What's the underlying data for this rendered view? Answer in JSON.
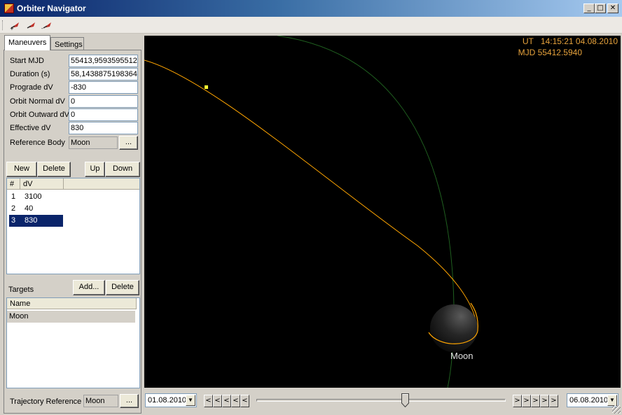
{
  "window": {
    "title": "Orbiter Navigator",
    "minimize": "_",
    "maximize": "□",
    "close": "✕"
  },
  "toolbar": {
    "icons": [
      "new-maneuver-icon",
      "edit-maneuver-icon",
      "delete-maneuver-icon"
    ]
  },
  "tabs": [
    {
      "label": "Maneuvers"
    },
    {
      "label": "Settings"
    }
  ],
  "maneuver_form": {
    "start_mjd": {
      "label": "Start MJD",
      "value": "55413,9593595512"
    },
    "duration": {
      "label": "Duration (s)",
      "value": "58,1438875198364"
    },
    "prograde": {
      "label": "Prograde dV",
      "value": "-830"
    },
    "normal": {
      "label": "Orbit Normal dV",
      "value": "0"
    },
    "outward": {
      "label": "Orbit Outward dV",
      "value": "0"
    },
    "effective": {
      "label": "Effective dV",
      "value": "830"
    },
    "reference": {
      "label": "Reference Body",
      "value": "Moon",
      "browse": "..."
    }
  },
  "maneuver_buttons": {
    "new": "New",
    "delete": "Delete",
    "up": "Up",
    "down": "Down"
  },
  "maneuver_list": {
    "columns": [
      "#",
      "dV"
    ],
    "rows": [
      {
        "num": "1",
        "dv": "3100"
      },
      {
        "num": "2",
        "dv": "40"
      },
      {
        "num": "3",
        "dv": "830"
      }
    ],
    "selected_index": 2
  },
  "targets": {
    "label": "Targets",
    "add": "Add...",
    "delete": "Delete",
    "column": "Name",
    "rows": [
      "Moon"
    ]
  },
  "trajectory": {
    "label": "Trajectory Reference",
    "value": "Moon",
    "browse": "..."
  },
  "hud": {
    "ut_label": "UT",
    "ut_time": "14:15:21 04.08.2010",
    "mjd": "MJD 55412.5940"
  },
  "viewport": {
    "body_label": "Moon",
    "trajectory_color": "#ffa500",
    "orbit_color": "#1f5f1f"
  },
  "timeline": {
    "start_date": "01.08.2010",
    "end_date": "06.08.2010",
    "back": "<",
    "forward": ">",
    "slider_position": 0.59
  }
}
